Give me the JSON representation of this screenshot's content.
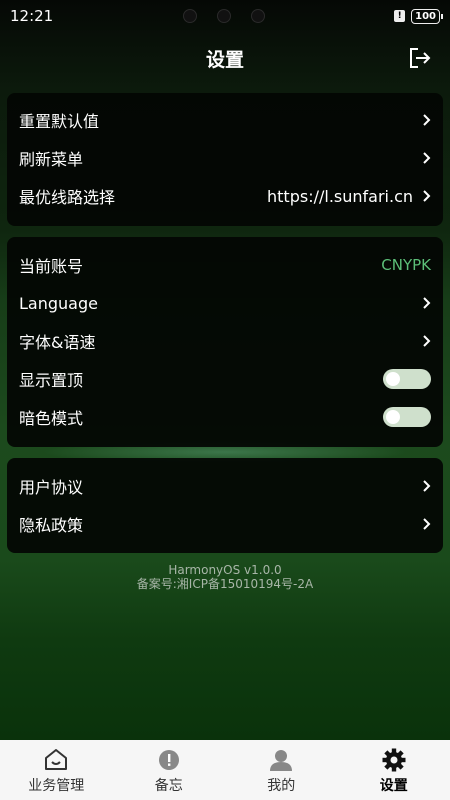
{
  "status_bar": {
    "time": "12:21",
    "battery": "100"
  },
  "header": {
    "title": "设置",
    "logout_icon": "logout-icon"
  },
  "group1": {
    "items": [
      {
        "label": "重置默认值",
        "value": ""
      },
      {
        "label": "刷新菜单",
        "value": ""
      },
      {
        "label": "最优线路选择",
        "value": "https://l.sunfari.cn"
      }
    ]
  },
  "group2": {
    "items": [
      {
        "label": "当前账号",
        "value": "CNYPK"
      },
      {
        "label": "Language",
        "value": ""
      },
      {
        "label": "字体&语速",
        "value": ""
      },
      {
        "label": "显示置顶",
        "toggle": false
      },
      {
        "label": "暗色模式",
        "toggle": false
      }
    ]
  },
  "group3": {
    "items": [
      {
        "label": "用户协议"
      },
      {
        "label": "隐私政策"
      }
    ]
  },
  "footer": {
    "version": "HarmonyOS v1.0.0",
    "icp": "备案号:湘ICP备15010194号-2A"
  },
  "tabbar": {
    "tabs": [
      {
        "label": "业务管理",
        "icon": "home-icon",
        "active": false
      },
      {
        "label": "备忘",
        "icon": "alert-icon",
        "active": false
      },
      {
        "label": "我的",
        "icon": "user-icon",
        "active": false
      },
      {
        "label": "设置",
        "icon": "gear-icon",
        "active": true
      }
    ]
  },
  "colors": {
    "accent_green": "#5cbf78",
    "toggle_off": "#cfe0cc"
  }
}
